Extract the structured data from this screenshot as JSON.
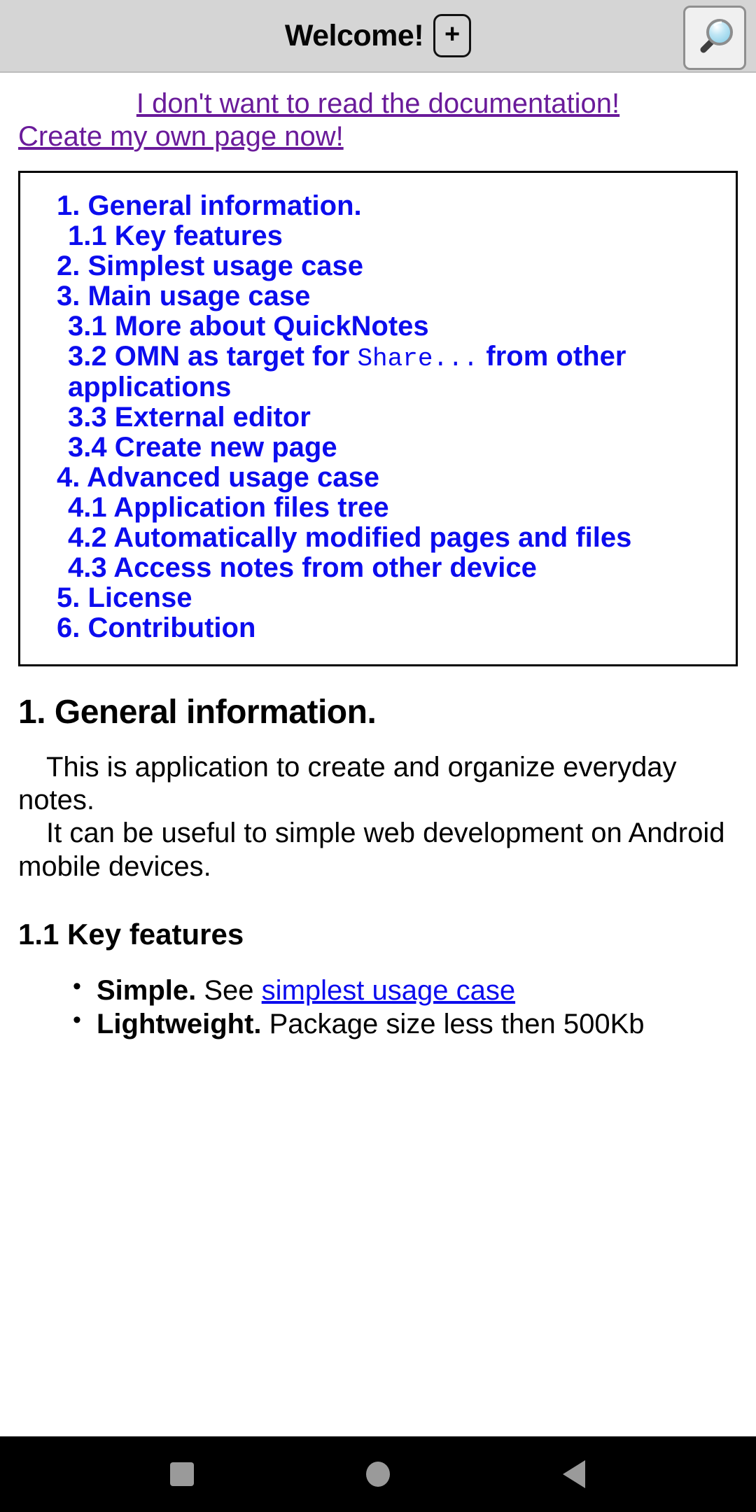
{
  "appbar": {
    "title": "Welcome!",
    "add_tab_label": "+",
    "search_icon": "search-magnifier-icon"
  },
  "intro_links": {
    "no_docs": "I don't want to read the documentation!",
    "create_page": "Create my own page now!",
    "link_color": "#6a1b9a"
  },
  "toc": {
    "link_color": "#0c0cee",
    "items": [
      {
        "label": "1. General information.",
        "level": 1
      },
      {
        "label": "1.1 Key features",
        "level": 2
      },
      {
        "label": "2. Simplest usage case",
        "level": 1
      },
      {
        "label": "3. Main usage case",
        "level": 1
      },
      {
        "label": "3.1 More about QuickNotes",
        "level": 2
      },
      {
        "label_pre": "3.2 OMN as target for ",
        "label_mono": "Share...",
        "label_post": " from other applications",
        "level": 2
      },
      {
        "label": "3.3 External editor",
        "level": 2
      },
      {
        "label": "3.4 Create new page",
        "level": 2
      },
      {
        "label": "4. Advanced usage case",
        "level": 1
      },
      {
        "label": "4.1 Application files tree",
        "level": 2
      },
      {
        "label": "4.2 Automatically modified pages and files",
        "level": 2
      },
      {
        "label": "4.3 Access notes from other device",
        "level": 2
      },
      {
        "label": "5. License",
        "level": 1
      },
      {
        "label": "6. Contribution",
        "level": 1
      }
    ]
  },
  "content": {
    "h_general": "1. General information.",
    "para1_line1": "This is application to create and organize everyday notes.",
    "para1_line2": "It can be useful to simple web development on Android mobile devices.",
    "h_keyfeatures": "1.1 Key features",
    "features": [
      {
        "term": "Simple.",
        "text": " See ",
        "link": "simplest usage case",
        "tail": ""
      },
      {
        "term": "Lightweight.",
        "text": " Package size less then 500Kb",
        "link": "",
        "tail": ""
      }
    ]
  },
  "navbar": {
    "recents": "recents-square-icon",
    "home": "home-circle-icon",
    "back": "back-triangle-icon"
  }
}
